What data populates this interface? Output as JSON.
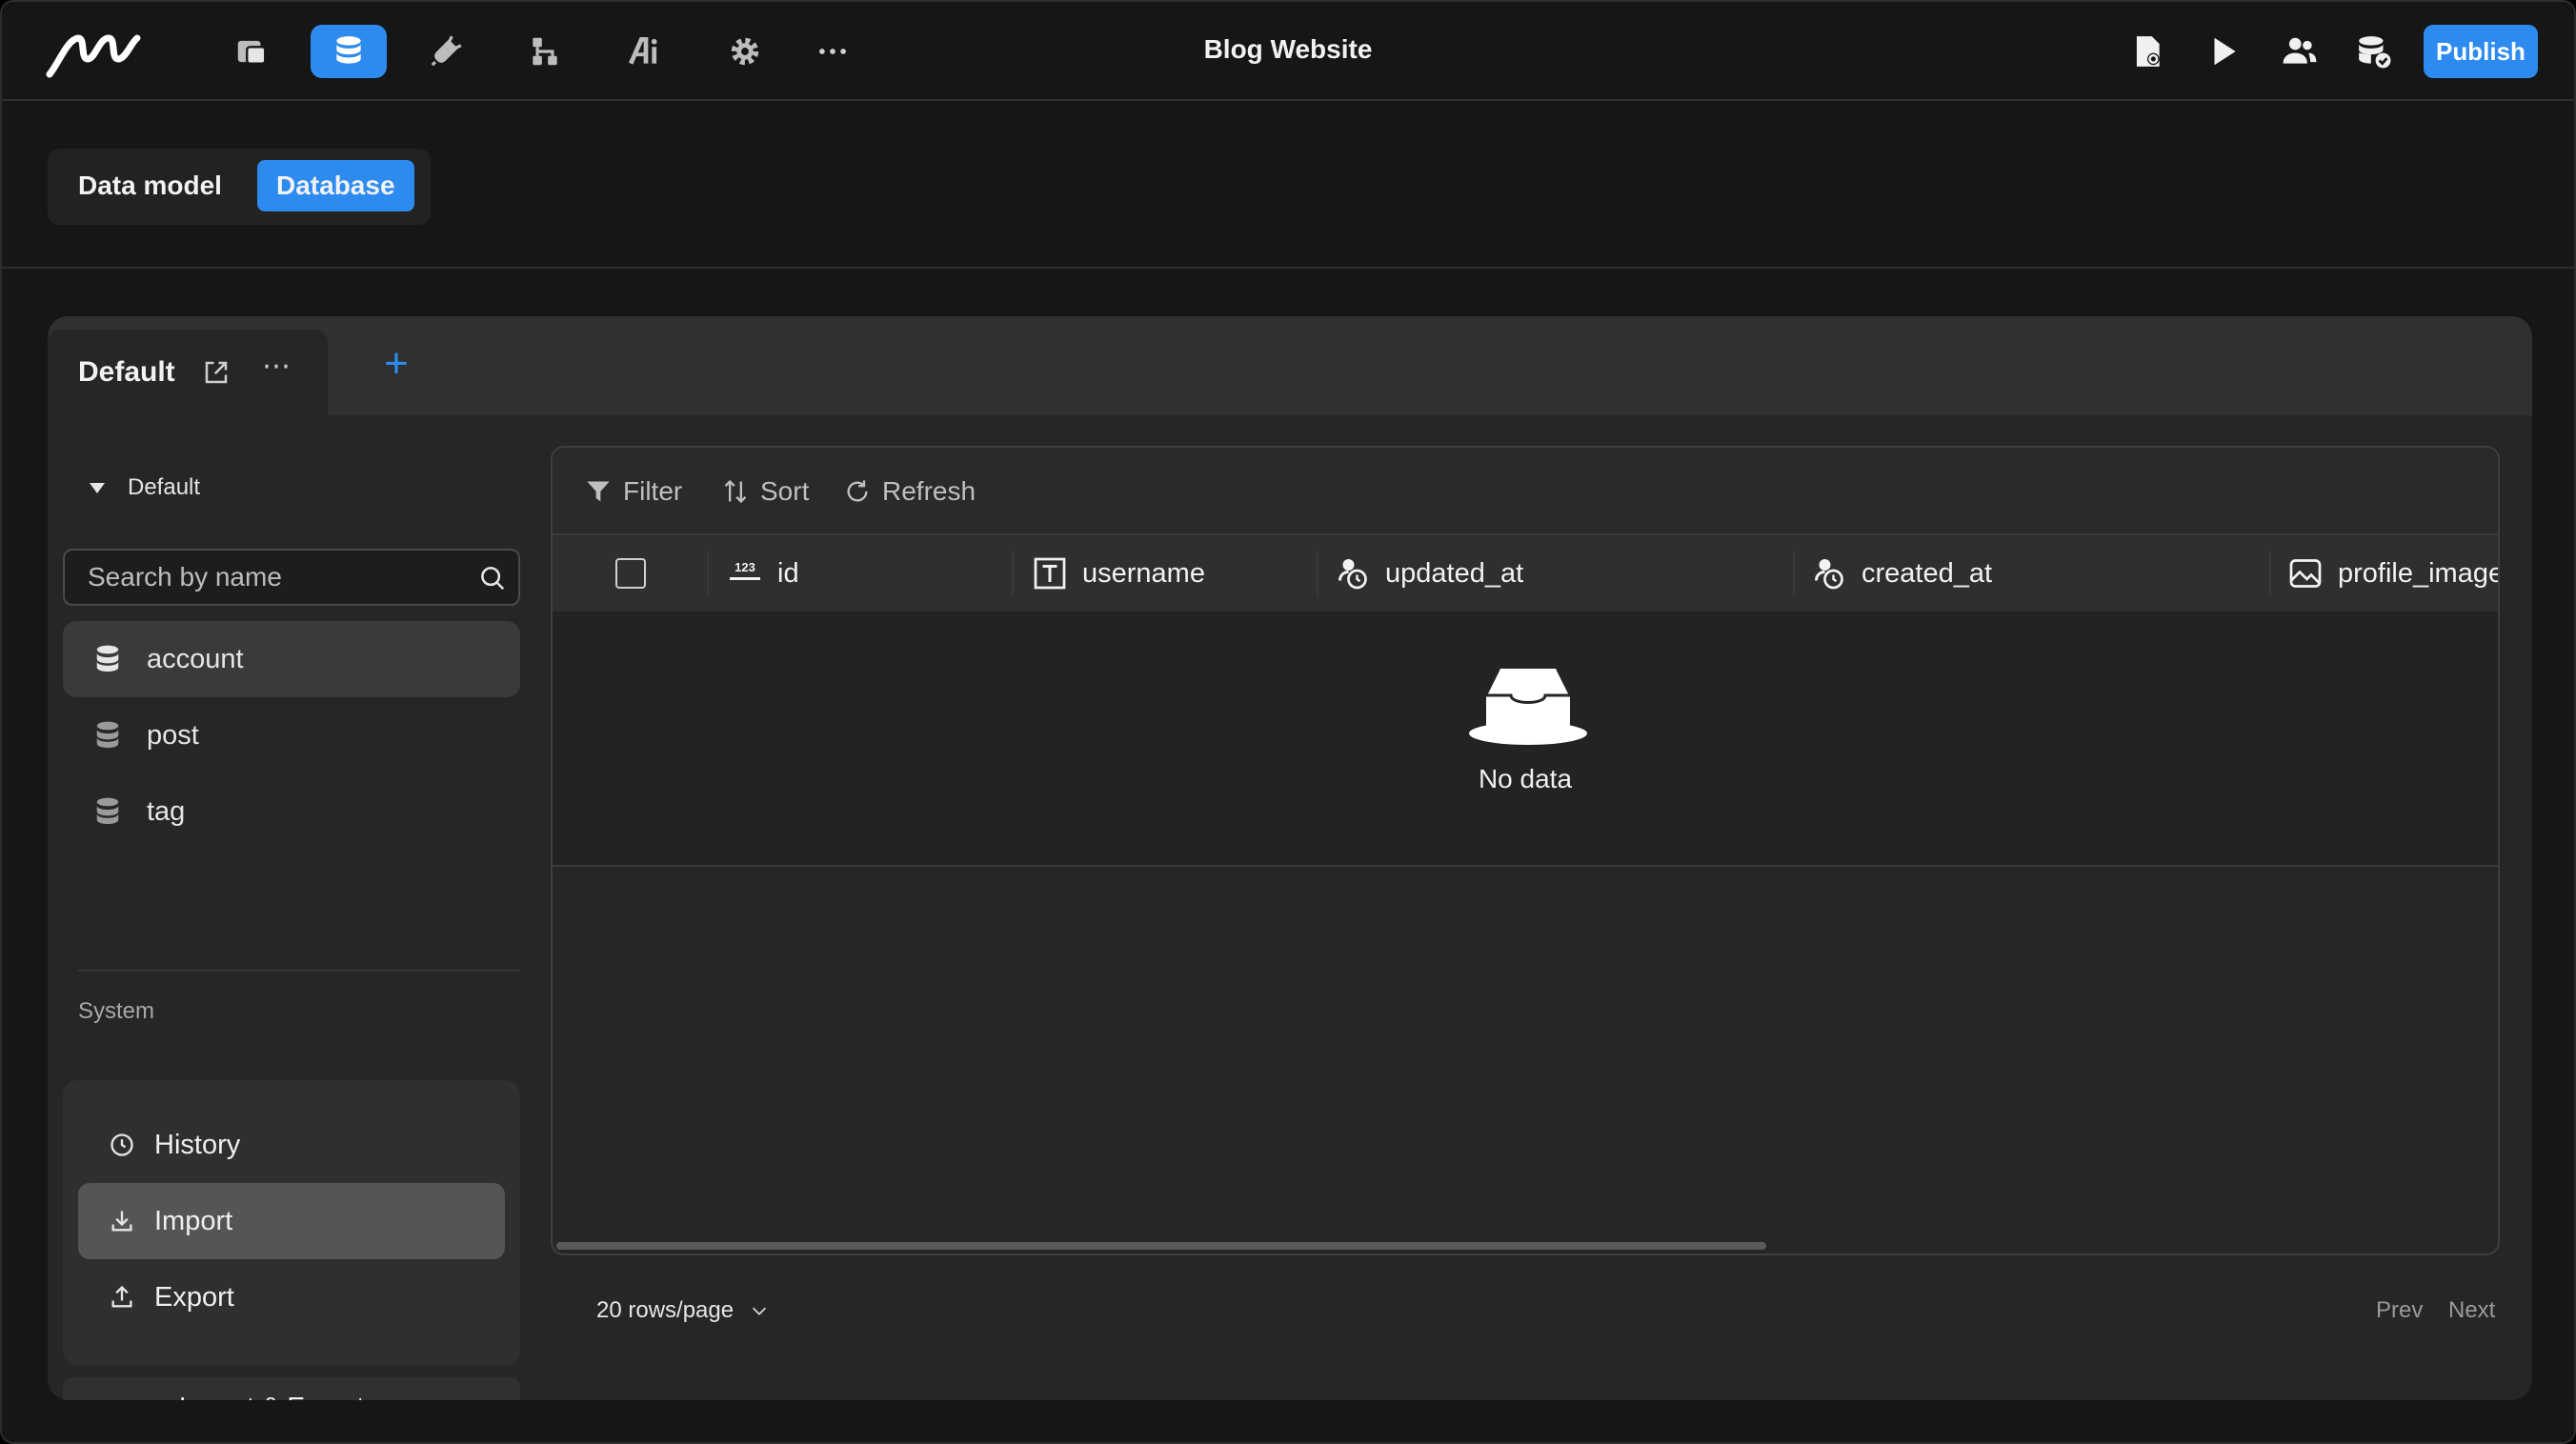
{
  "app": {
    "title": "Blog Website",
    "publish_label": "Publish",
    "accent_color": "#2d8bf0"
  },
  "toolbar_left_icons": [
    "pages-icon",
    "database-icon",
    "plugin-icon",
    "workflow-icon",
    "ai-icon",
    "settings-icon",
    "more-icon"
  ],
  "toolbar_right_icons": [
    "page-settings-icon",
    "play-icon",
    "users-icon",
    "database-check-icon"
  ],
  "segment": {
    "items": [
      "Data model",
      "Database"
    ],
    "active": "Database"
  },
  "tabs": {
    "items": [
      {
        "label": "Default"
      }
    ],
    "add_label": "+"
  },
  "sidebar": {
    "group_label": "Default",
    "search_placeholder": "Search by name",
    "tables": [
      {
        "label": "account"
      },
      {
        "label": "post"
      },
      {
        "label": "tag"
      }
    ],
    "active_table": "account",
    "system_label": "System",
    "system_items": [
      {
        "label": "History",
        "icon": "history-icon"
      },
      {
        "label": "Import",
        "icon": "import-icon"
      },
      {
        "label": "Export",
        "icon": "export-icon"
      }
    ],
    "active_system": "Import",
    "import_export_label": "Import & Export"
  },
  "grid": {
    "toolbar": {
      "filter": "Filter",
      "sort": "Sort",
      "refresh": "Refresh"
    },
    "columns": [
      {
        "label": "id",
        "icon": "number-icon"
      },
      {
        "label": "username",
        "icon": "text-icon"
      },
      {
        "label": "updated_at",
        "icon": "datetime-icon"
      },
      {
        "label": "created_at",
        "icon": "datetime-icon"
      },
      {
        "label": "profile_image",
        "icon": "image-icon"
      }
    ],
    "empty_text": "No data",
    "number_icon_text": "123"
  },
  "pagination": {
    "rows_per_page": "20 rows/page",
    "prev": "Prev",
    "next": "Next"
  }
}
